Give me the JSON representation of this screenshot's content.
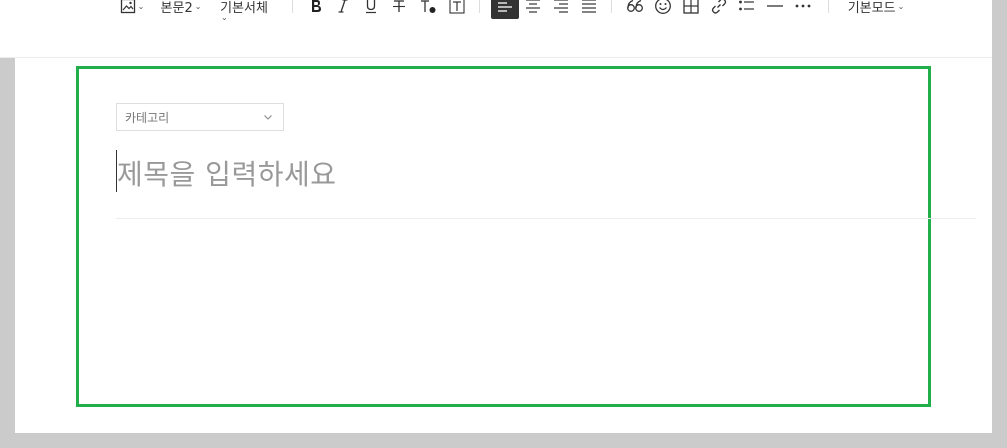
{
  "toolbar": {
    "paragraph_style": "본문2",
    "font_family": "기본서체",
    "mode": "기본모드"
  },
  "category": {
    "placeholder": "카테고리"
  },
  "title": {
    "placeholder": "제목을 입력하세요"
  },
  "colors": {
    "frame_highlight": "#22ae4a",
    "active_button": "#333333"
  },
  "icons": [
    "image-icon",
    "bold-icon",
    "italic-icon",
    "underline-icon",
    "strikethrough-icon",
    "text-color-icon",
    "text-background-icon",
    "align-left-icon",
    "align-center-icon",
    "align-right-icon",
    "align-justify-icon",
    "quote-icon",
    "emoji-icon",
    "table-icon",
    "link-icon",
    "list-icon",
    "divider-icon",
    "more-icon"
  ]
}
